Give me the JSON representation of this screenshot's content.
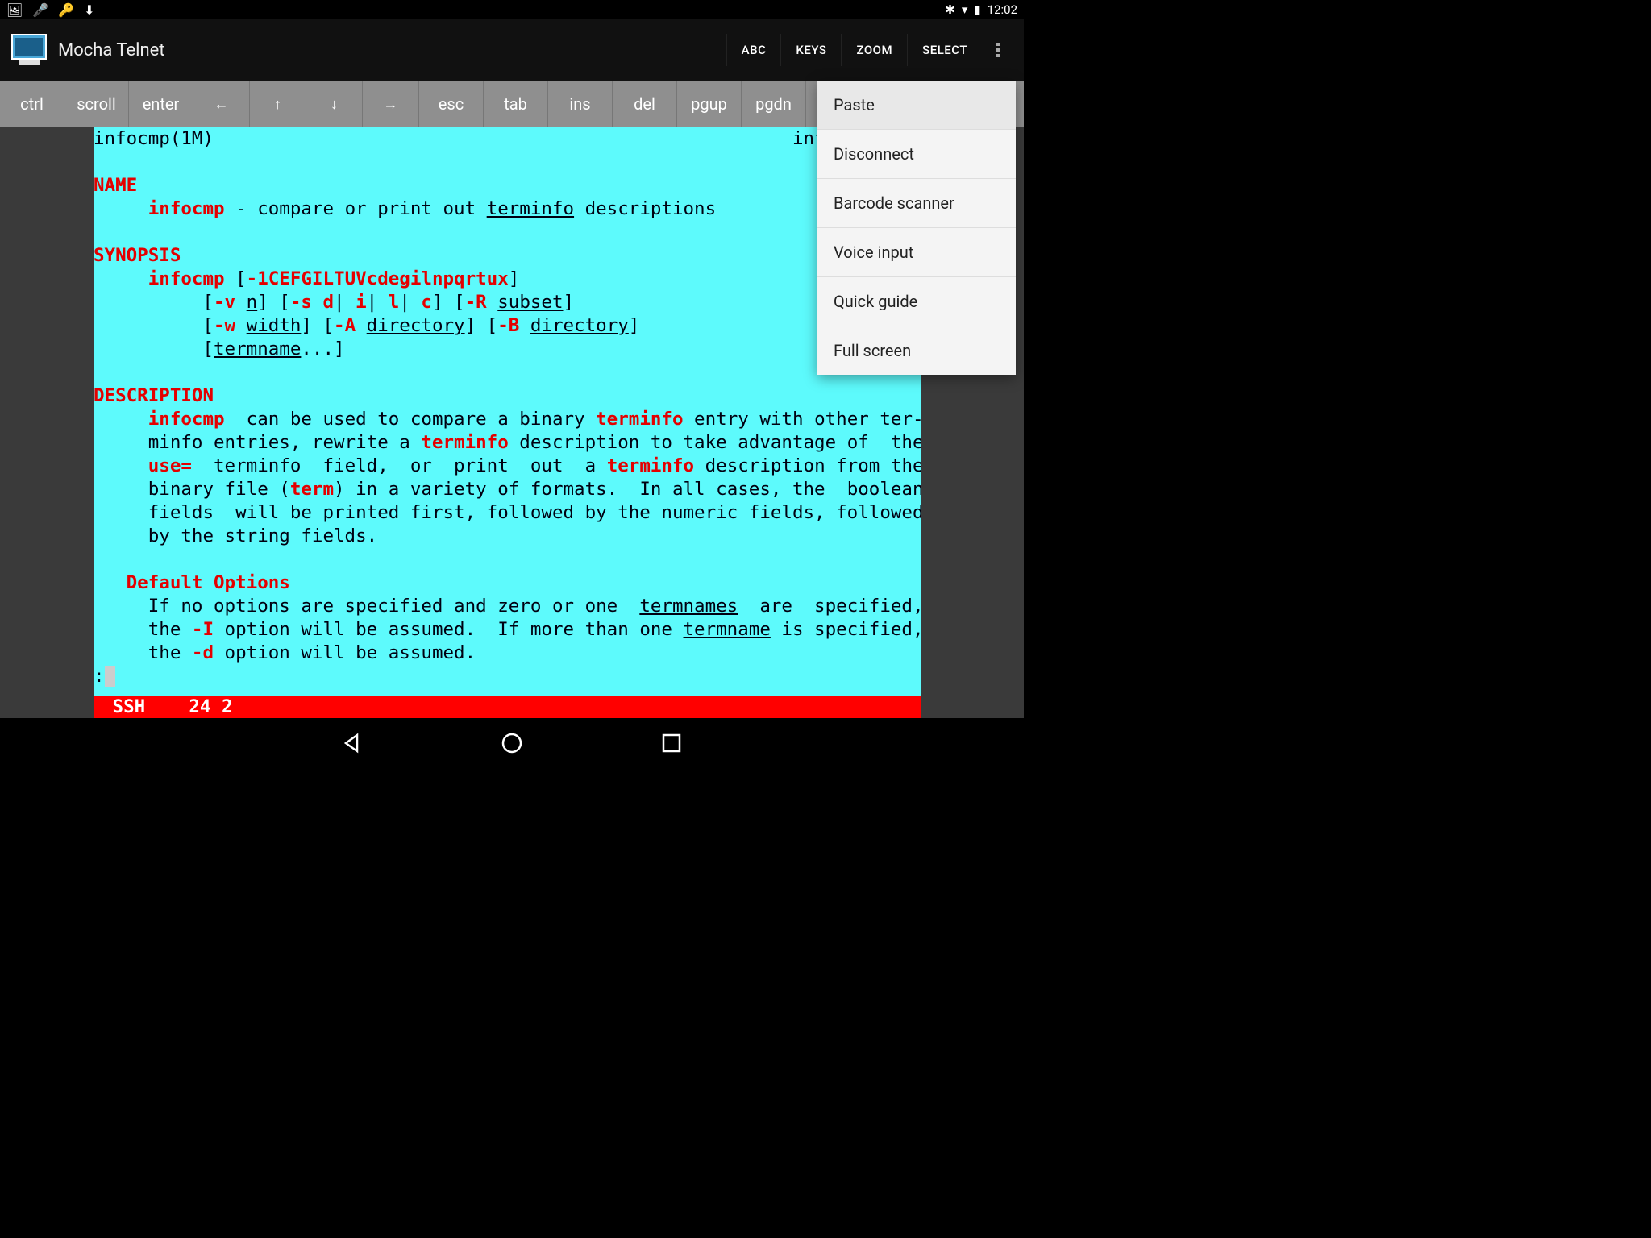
{
  "status_bar": {
    "time": "12:02"
  },
  "app": {
    "title": "Mocha Telnet"
  },
  "actions": {
    "abc": "ABC",
    "keys": "KEYS",
    "zoom": "ZOOM",
    "select": "SELECT"
  },
  "keys": {
    "ctrl": "ctrl",
    "scroll": "scroll",
    "enter": "enter",
    "left": "←",
    "up": "↑",
    "down": "↓",
    "right": "→",
    "esc": "esc",
    "tab": "tab",
    "ins": "ins",
    "del": "del",
    "pgup": "pgup",
    "pgdn": "pgdn"
  },
  "menu": {
    "paste": "Paste",
    "disconnect": "Disconnect",
    "barcode": "Barcode scanner",
    "voice": "Voice input",
    "guide": "Quick guide",
    "fullscreen": "Full screen"
  },
  "term": {
    "header_left": "infocmp(1M)",
    "header_right": "inf",
    "name_hdr": "NAME",
    "name_cmd": "infocmp",
    "name_rest": " - compare or print out ",
    "terminfo": "terminfo",
    "name_tail": " descriptions",
    "syn_hdr": "SYNOPSIS",
    "syn_l1a": "     infocmp",
    "syn_l1b": " [",
    "syn_l1c": "-1CEFGILTUVcdegilnpqrtux",
    "syn_l1d": "]",
    "syn_l2a": "          [",
    "syn_l2b": "-v",
    "syn_l2c": " ",
    "syn_l2d": "n",
    "syn_l2e": "] [",
    "syn_l2f": "-s d",
    "syn_l2g": "| ",
    "syn_l2h": "i",
    "syn_l2i": "| ",
    "syn_l2j": "l",
    "syn_l2k": "| ",
    "syn_l2l": "c",
    "syn_l2m": "] [",
    "syn_l2n": "-R",
    "syn_l2o": " ",
    "syn_l2p": "subset",
    "syn_l2q": "]",
    "syn_l3a": "          [",
    "syn_l3b": "-w",
    "syn_l3c": " ",
    "syn_l3d": "width",
    "syn_l3e": "] [",
    "syn_l3f": "-A",
    "syn_l3g": " ",
    "syn_l3h": "directory",
    "syn_l3i": "] [",
    "syn_l3j": "-B",
    "syn_l3k": " ",
    "syn_l3l": "directory",
    "syn_l3m": "]",
    "syn_l4a": "          [",
    "syn_l4b": "termname",
    "syn_l4c": "...]",
    "desc_hdr": "DESCRIPTION",
    "desc_l1a": "     ",
    "desc_l1b": "infocmp",
    "desc_l1c": "  can be used to compare a binary ",
    "desc_l1d": "terminfo",
    "desc_l1e": " entry with other ter-",
    "desc_l2a": "     minfo entries, rewrite a ",
    "desc_l2b": "terminfo",
    "desc_l2c": " description to take advantage of  the",
    "desc_l3a": "     ",
    "desc_l3b": "use=",
    "desc_l3c": "  terminfo  field,  or  print  out  a ",
    "desc_l3d": "terminfo",
    "desc_l3e": " description from the",
    "desc_l4a": "     binary file (",
    "desc_l4b": "term",
    "desc_l4c": ") in a variety of formats.  In all cases, the  boolean",
    "desc_l5": "     fields  will be printed first, followed by the numeric fields, followed",
    "desc_l6": "     by the string fields.",
    "defopt_hdr": "   Default Options",
    "do_l1a": "     If no options are specified and zero or one  ",
    "do_l1b": "termnames",
    "do_l1c": "  are  specified,",
    "do_l2a": "     the ",
    "do_l2b": "-I",
    "do_l2c": " option will be assumed.  If more than one ",
    "do_l2d": "termname",
    "do_l2e": " is specified,",
    "do_l3a": "     the ",
    "do_l3b": "-d",
    "do_l3c": " option will be assumed.",
    "prompt": ":",
    "status_proto": "SSH",
    "status_pos": "24 2"
  }
}
